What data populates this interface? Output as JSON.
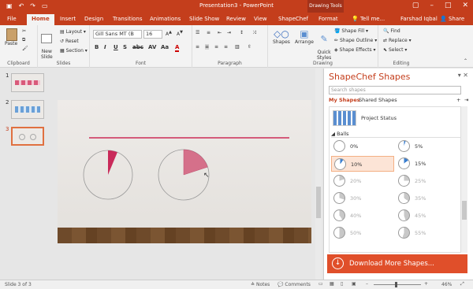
{
  "titlebar": {
    "title": "Presentation3 - PowerPoint",
    "context_tab": "Drawing Tools",
    "brand_color": "#c43e1c"
  },
  "tabs": {
    "file": "File",
    "home": "Home",
    "insert": "Insert",
    "design": "Design",
    "transitions": "Transitions",
    "animations": "Animations",
    "slideshow": "Slide Show",
    "review": "Review",
    "view": "View",
    "shapechef": "ShapeChef",
    "format": "Format",
    "tellme": "Tell me...",
    "user": "Farshad Iqbal",
    "share": "Share"
  },
  "ribbon": {
    "clipboard": {
      "label": "Clipboard",
      "paste": "Paste"
    },
    "slides": {
      "label": "Slides",
      "new_slide": "New\nSlide",
      "layout": "Layout",
      "reset": "Reset",
      "section": "Section"
    },
    "font": {
      "label": "Font",
      "family": "Gill Sans MT (B",
      "size": "16"
    },
    "paragraph": {
      "label": "Paragraph"
    },
    "drawing": {
      "label": "Drawing",
      "shapes": "Shapes",
      "arrange": "Arrange",
      "quick_styles": "Quick\nStyles",
      "fill": "Shape Fill",
      "outline": "Shape Outline",
      "effects": "Shape Effects"
    },
    "editing": {
      "label": "Editing",
      "find": "Find",
      "replace": "Replace",
      "select": "Select"
    }
  },
  "thumbnails": [
    {
      "num": "1"
    },
    {
      "num": "2"
    },
    {
      "num": "3"
    }
  ],
  "pane": {
    "title": "ShapeChef Shapes",
    "search_placeholder": "Search shapes",
    "tab_my": "My Shapes",
    "tab_shared": "Shared Shapes",
    "project_item": "Project Status",
    "category": "Balls",
    "balls": [
      {
        "label": "0%",
        "value": 0
      },
      {
        "label": "5%",
        "value": 5
      },
      {
        "label": "10%",
        "value": 10
      },
      {
        "label": "15%",
        "value": 15
      },
      {
        "label": "20%",
        "value": 20
      },
      {
        "label": "25%",
        "value": 25
      },
      {
        "label": "30%",
        "value": 30
      },
      {
        "label": "35%",
        "value": 35
      },
      {
        "label": "40%",
        "value": 40
      },
      {
        "label": "45%",
        "value": 45
      },
      {
        "label": "50%",
        "value": 50
      },
      {
        "label": "55%",
        "value": 55
      }
    ],
    "download": "Download More Shapes..."
  },
  "status": {
    "slide": "Slide 3 of 3",
    "notes": "Notes",
    "comments": "Comments",
    "zoom": "46%"
  }
}
